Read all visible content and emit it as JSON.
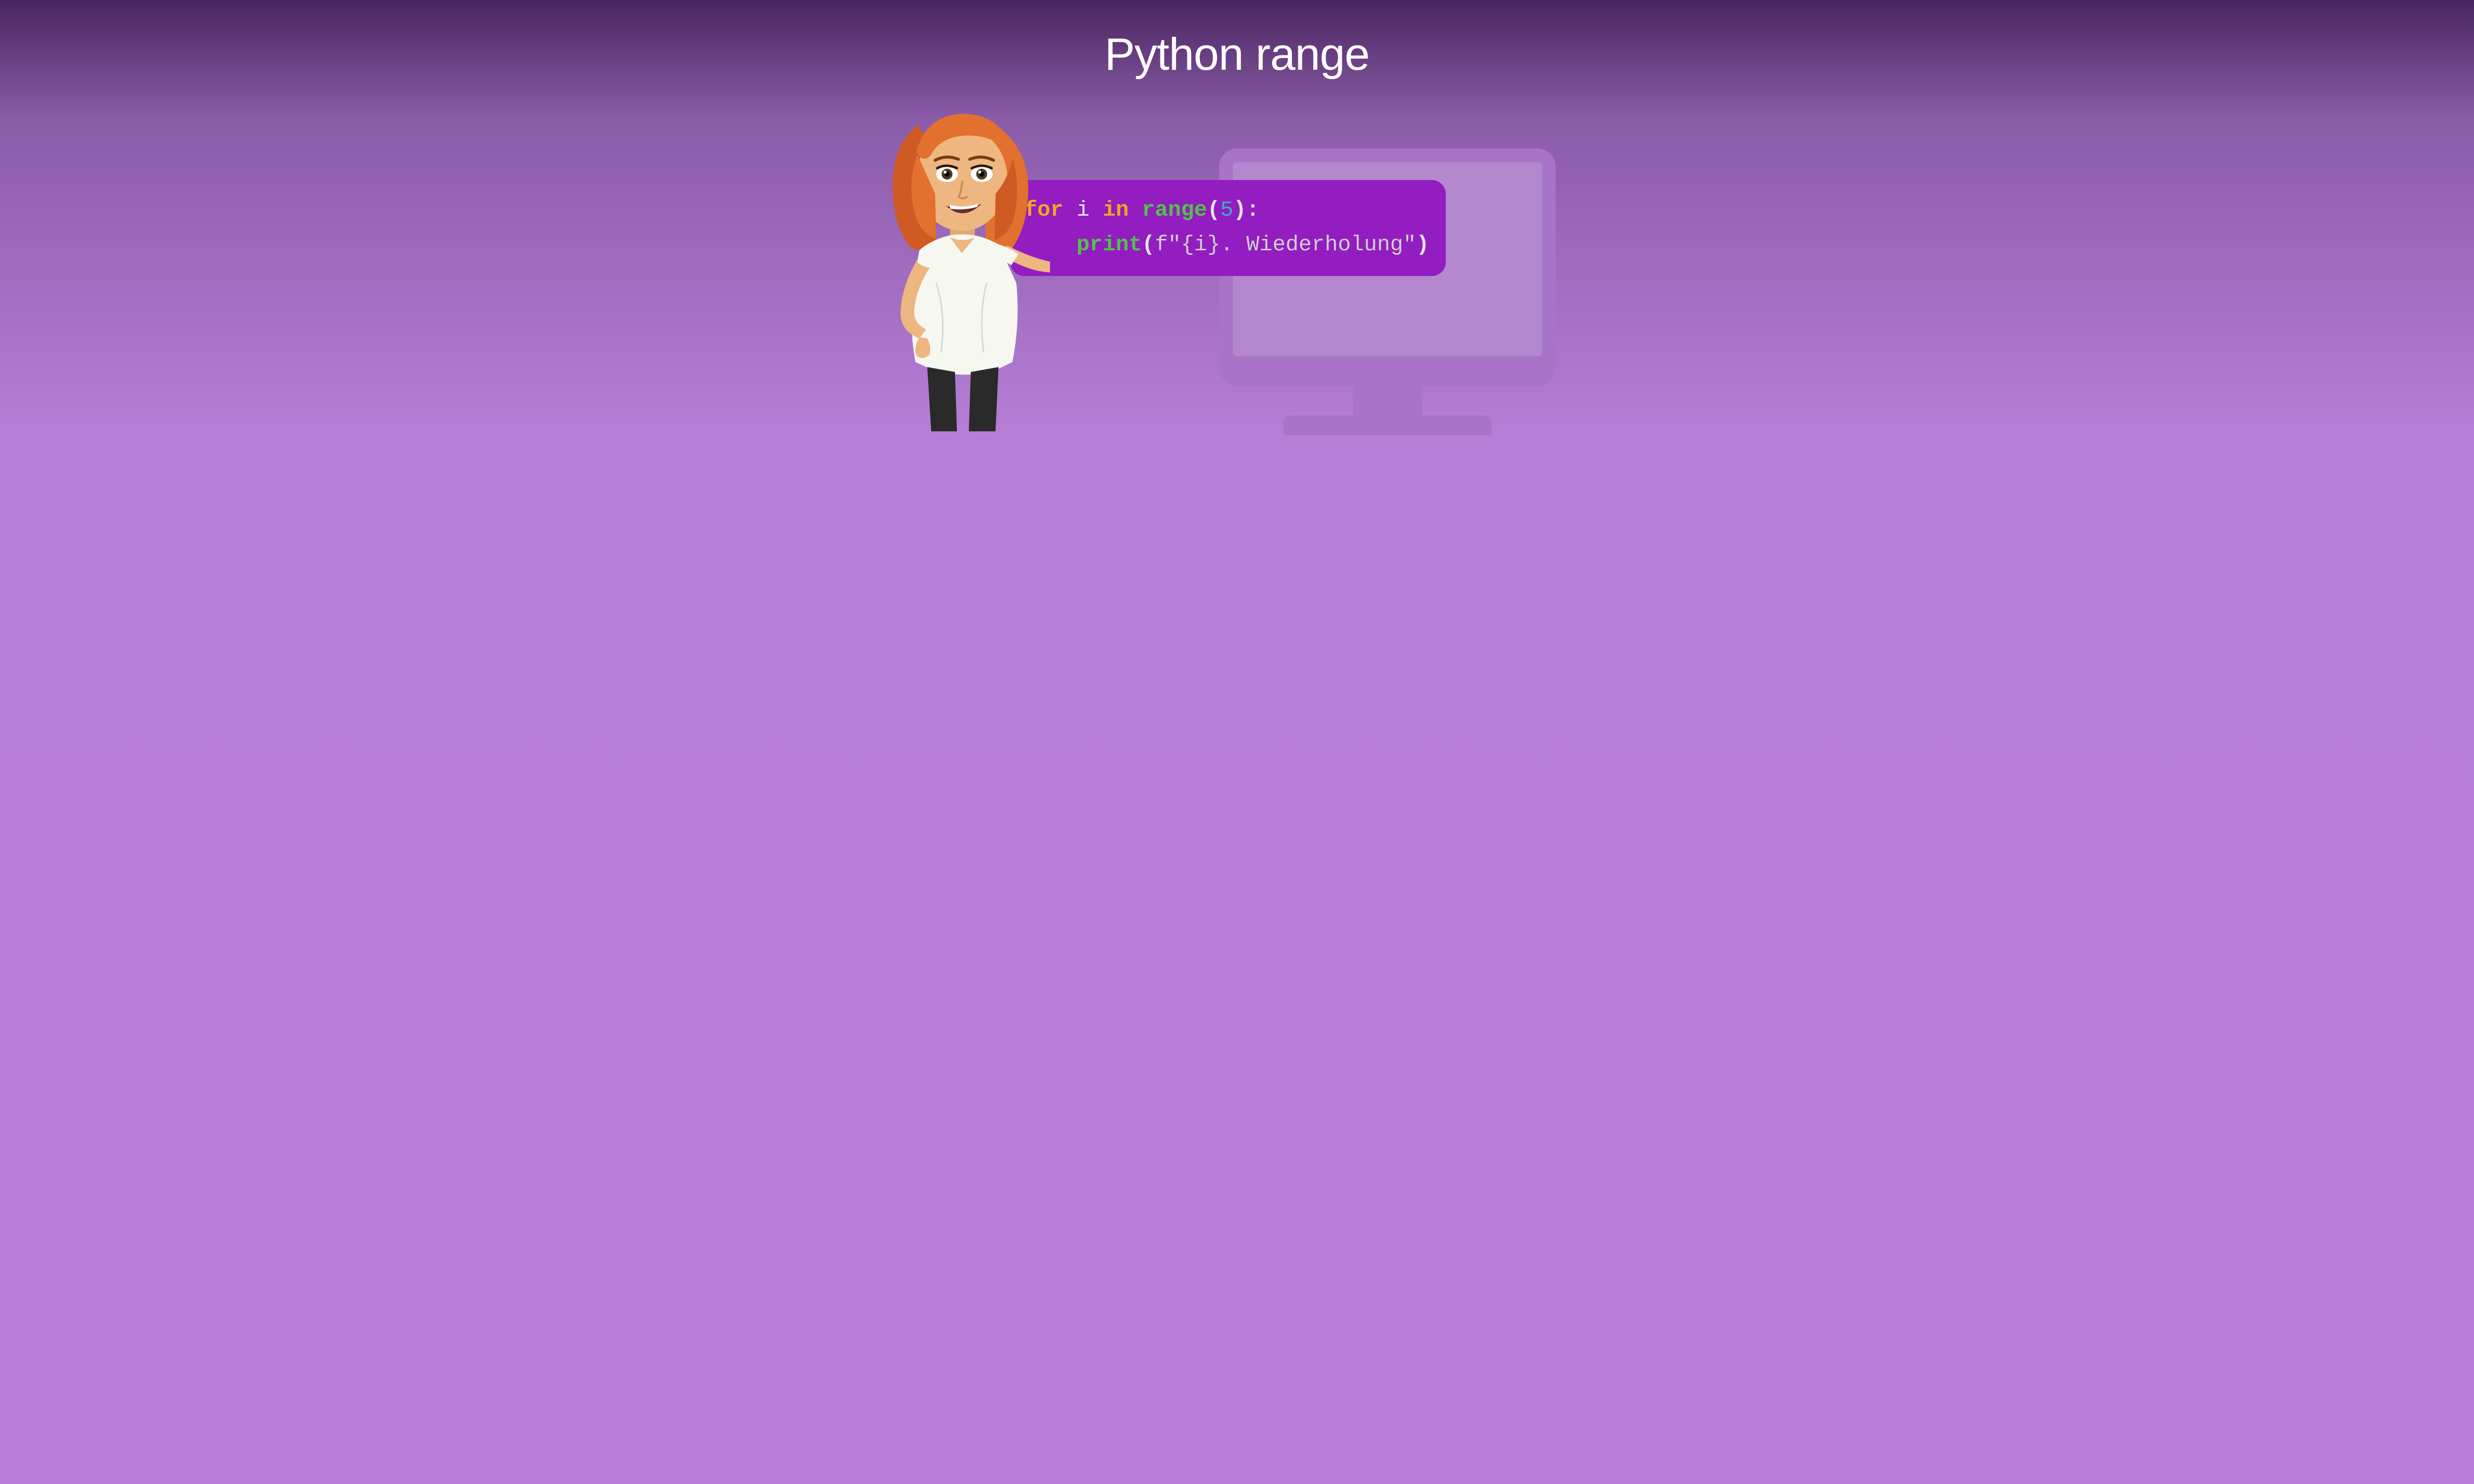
{
  "title": "Python range",
  "code": {
    "line1": {
      "for": "for",
      "i": "i",
      "in": "in",
      "range": "range",
      "open": "(",
      "num": "5",
      "close": ")",
      "colon": ":"
    },
    "line2": {
      "indent": "    ",
      "print": "print",
      "open": "(",
      "f": "f",
      "q1": "\"",
      "braceOpen": "{",
      "var": "i",
      "braceClose": "}",
      "dot": ". ",
      "word": "Wiederholung",
      "q2": "\"",
      "close": ")"
    }
  },
  "colors": {
    "keyword": "#f3a522",
    "function": "#52c24a",
    "number": "#35b2c9",
    "identifier": "#e6e6e6",
    "string": "#cfcfcf",
    "bubble": "#931dc0"
  }
}
